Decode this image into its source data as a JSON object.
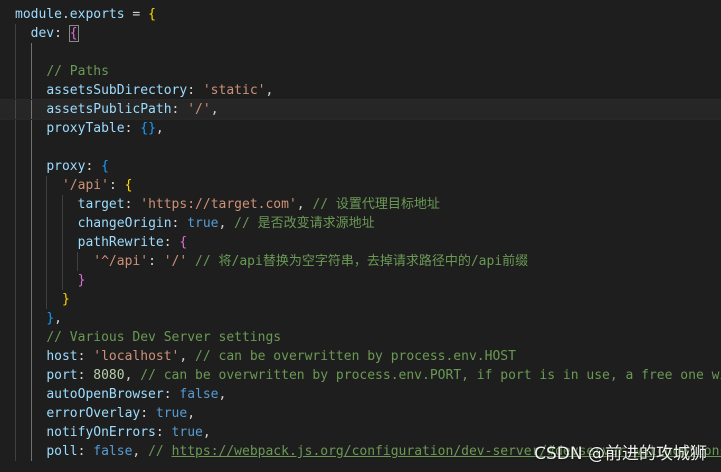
{
  "colors": {
    "background": "#1e1e1e",
    "plain": "#d4d4d4",
    "variable": "#9cdcfe",
    "string": "#ce9178",
    "number": "#b5cea8",
    "keyword": "#569cd6",
    "comment": "#6a9955",
    "bracket_gold": "#ffd700",
    "bracket_purple": "#da70d6",
    "bracket_blue": "#179fff",
    "function": "#dcdcaa"
  },
  "watermark": "CSDN @前进的攻城狮",
  "code_lines": [
    [
      [
        "module",
        "variable"
      ],
      [
        ".",
        "plain"
      ],
      [
        "exports",
        "variable"
      ],
      [
        " = ",
        "plain"
      ],
      [
        "{",
        "bracket_gold"
      ]
    ],
    [
      [
        "  ",
        "plain"
      ],
      [
        "dev",
        "variable"
      ],
      [
        ": ",
        "plain"
      ],
      [
        "{",
        "bracket_purple_box"
      ]
    ],
    [],
    [
      [
        "    ",
        "plain"
      ],
      [
        "// Paths",
        "comment"
      ]
    ],
    [
      [
        "    ",
        "plain"
      ],
      [
        "assetsSubDirectory",
        "variable"
      ],
      [
        ": ",
        "plain"
      ],
      [
        "'static'",
        "string"
      ],
      [
        ",",
        "plain"
      ]
    ],
    [
      [
        "    ",
        "plain"
      ],
      [
        "assetsPublicPath",
        "variable"
      ],
      [
        ": ",
        "plain"
      ],
      [
        "'/'",
        "string"
      ],
      [
        ",",
        "plain"
      ]
    ],
    [
      [
        "    ",
        "plain"
      ],
      [
        "proxyTable",
        "variable"
      ],
      [
        ": ",
        "plain"
      ],
      [
        "{}",
        "bracket_blue"
      ],
      [
        ",",
        "plain"
      ]
    ],
    [],
    [
      [
        "    ",
        "plain"
      ],
      [
        "proxy",
        "variable"
      ],
      [
        ": ",
        "plain"
      ],
      [
        "{",
        "bracket_blue"
      ]
    ],
    [
      [
        "      ",
        "plain"
      ],
      [
        "'/api'",
        "string"
      ],
      [
        ": ",
        "plain"
      ],
      [
        "{",
        "bracket_gold"
      ]
    ],
    [
      [
        "        ",
        "plain"
      ],
      [
        "target",
        "variable"
      ],
      [
        ": ",
        "plain"
      ],
      [
        "'https://target.com'",
        "string"
      ],
      [
        ", ",
        "plain"
      ],
      [
        "// 设置代理目标地址",
        "comment"
      ]
    ],
    [
      [
        "        ",
        "plain"
      ],
      [
        "changeOrigin",
        "variable"
      ],
      [
        ": ",
        "plain"
      ],
      [
        "true",
        "keyword"
      ],
      [
        ", ",
        "plain"
      ],
      [
        "// 是否改变请求源地址",
        "comment"
      ]
    ],
    [
      [
        "        ",
        "plain"
      ],
      [
        "pathRewrite",
        "variable"
      ],
      [
        ": ",
        "plain"
      ],
      [
        "{",
        "bracket_purple"
      ]
    ],
    [
      [
        "          ",
        "plain"
      ],
      [
        "'^/api'",
        "string"
      ],
      [
        ": ",
        "plain"
      ],
      [
        "'/'",
        "string"
      ],
      [
        " ",
        "plain"
      ],
      [
        "// 将/api替换为空字符串，去掉请求路径中的/api前缀",
        "comment"
      ]
    ],
    [
      [
        "        ",
        "plain"
      ],
      [
        "}",
        "bracket_purple"
      ]
    ],
    [
      [
        "      ",
        "plain"
      ],
      [
        "}",
        "bracket_gold"
      ]
    ],
    [
      [
        "    ",
        "plain"
      ],
      [
        "}",
        "bracket_blue"
      ],
      [
        ",",
        "plain"
      ]
    ],
    [
      [
        "    ",
        "plain"
      ],
      [
        "// Various Dev Server settings",
        "comment"
      ]
    ],
    [
      [
        "    ",
        "plain"
      ],
      [
        "host",
        "variable"
      ],
      [
        ": ",
        "plain"
      ],
      [
        "'localhost'",
        "string"
      ],
      [
        ", ",
        "plain"
      ],
      [
        "// can be overwritten by process.env.HOST",
        "comment"
      ]
    ],
    [
      [
        "    ",
        "plain"
      ],
      [
        "port",
        "variable"
      ],
      [
        ": ",
        "plain"
      ],
      [
        "8080",
        "number"
      ],
      [
        ", ",
        "plain"
      ],
      [
        "// can be overwritten by process.env.PORT, if port is in use, a free one will be determined",
        "comment"
      ]
    ],
    [
      [
        "    ",
        "plain"
      ],
      [
        "autoOpenBrowser",
        "variable"
      ],
      [
        ": ",
        "plain"
      ],
      [
        "false",
        "keyword"
      ],
      [
        ",",
        "plain"
      ]
    ],
    [
      [
        "    ",
        "plain"
      ],
      [
        "errorOverlay",
        "variable"
      ],
      [
        ": ",
        "plain"
      ],
      [
        "true",
        "keyword"
      ],
      [
        ",",
        "plain"
      ]
    ],
    [
      [
        "    ",
        "plain"
      ],
      [
        "notifyOnErrors",
        "variable"
      ],
      [
        ": ",
        "plain"
      ],
      [
        "true",
        "keyword"
      ],
      [
        ",",
        "plain"
      ]
    ],
    [
      [
        "    ",
        "plain"
      ],
      [
        "poll",
        "variable"
      ],
      [
        ": ",
        "plain"
      ],
      [
        "false",
        "keyword"
      ],
      [
        ", ",
        "plain"
      ],
      [
        "// ",
        "comment"
      ],
      [
        "https://webpack.js.org/configuration/dev-server/#devserver-watchoptions-",
        "comment_link"
      ]
    ]
  ]
}
